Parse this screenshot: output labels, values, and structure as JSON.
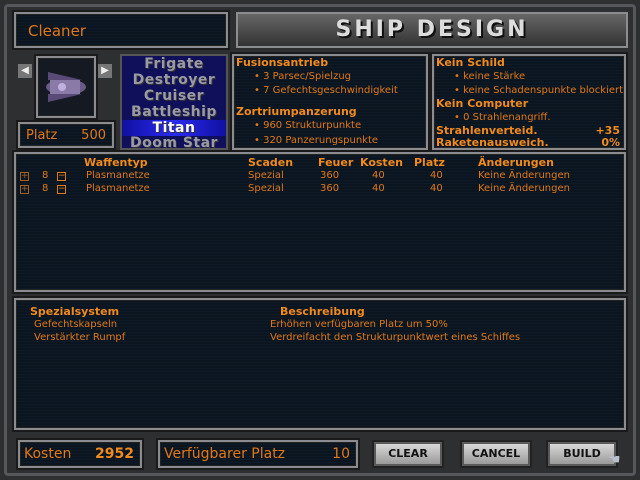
{
  "design_name": "Cleaner",
  "banner": "SHIP DESIGN",
  "platz": {
    "label": "Platz",
    "value": "500"
  },
  "classes": [
    "Frigate",
    "Destroyer",
    "Cruiser",
    "Battleship",
    "Titan",
    "Doom Star"
  ],
  "selected_class": "Titan",
  "drive": {
    "title": "Fusionsantrieb",
    "items": [
      "• 3 Parsec/Spielzug",
      "• 7 Gefechtsgeschwindigkeit"
    ]
  },
  "armor": {
    "title": "Zortriumpanzerung",
    "items": [
      "• 960 Strukturpunkte",
      "• 320 Panzerungspunkte"
    ]
  },
  "shield": {
    "title": "Kein Schild",
    "items": [
      "• keine Stärke",
      "• keine Schadenspunkte blockiert"
    ]
  },
  "computer": {
    "title": "Kein Computer",
    "items": [
      "• 0 Strahlenangriff."
    ]
  },
  "stats": [
    {
      "label": "Strahlenverteid.",
      "value": "+35"
    },
    {
      "label": "Raketenausweich.",
      "value": "0%"
    }
  ],
  "weapons": {
    "headers": [
      "Waffentyp",
      "Scaden",
      "Feuer",
      "Kosten",
      "Platz",
      "Änderungen"
    ],
    "rows": [
      {
        "count": "8",
        "name": "Plasmanetze",
        "damage": "Spezial",
        "fire": "360",
        "cost": "40",
        "space": "40",
        "mods": "Keine Änderungen"
      },
      {
        "count": "8",
        "name": "Plasmanetze",
        "damage": "Spezial",
        "fire": "360",
        "cost": "40",
        "space": "40",
        "mods": "Keine Änderungen"
      }
    ]
  },
  "specials": {
    "headers": [
      "Spezialsystem",
      "Beschreibung"
    ],
    "rows": [
      {
        "name": "Gefechtskapseln",
        "desc": "Erhöhen verfügbaren Platz um 50%"
      },
      {
        "name": "Verstärkter Rumpf",
        "desc": "Verdreifacht den Strukturpunktwert eines Schiffes"
      }
    ]
  },
  "footer": {
    "cost_label": "Kosten",
    "cost": "2952",
    "space_label": "Verfügbarer Platz",
    "space": "10"
  },
  "buttons": {
    "clear": "CLEAR",
    "cancel": "CANCEL",
    "build": "BUILD"
  },
  "colors": {
    "text": "#e07818",
    "panel": "#0b1520",
    "class_bg": "#10105a"
  }
}
